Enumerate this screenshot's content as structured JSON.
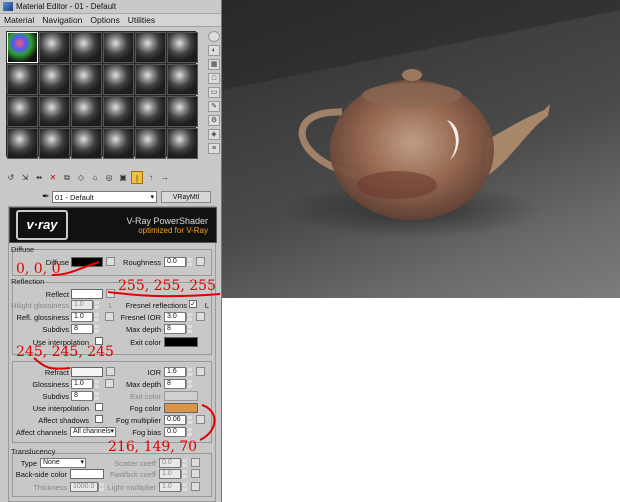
{
  "window": {
    "title": "Material Editor - 01 - Default"
  },
  "menu": [
    "Material",
    "Navigation",
    "Options",
    "Utilities"
  ],
  "material": {
    "name": "01 - Default",
    "type": "VRayMtl"
  },
  "banner": {
    "logo": "v·ray",
    "title": "V-Ray PowerShader",
    "subtitle": "optimized for V-Ray"
  },
  "diffuse": {
    "section": "Diffuse",
    "diffuse_label": "Diffuse",
    "diffuse_color": "#000000",
    "roughness_label": "Roughness",
    "roughness": "0.0"
  },
  "reflection": {
    "section": "Reflection",
    "reflect_label": "Reflect",
    "reflect_color": "#ffffff",
    "hilight_label": "Hilight glossiness",
    "hilight": "1.0",
    "L": "L",
    "fresnel_label": "Fresnel reflections",
    "fresnel_checked": "✓",
    "fresnel_L": "L",
    "refl_gloss_label": "Refl. glossiness",
    "refl_gloss": "1.0",
    "fresnel_ior_label": "Fresnel IOR",
    "fresnel_ior": "3.0",
    "subdivs_label": "Subdivs",
    "subdivs": "8",
    "maxdepth_label": "Max depth",
    "maxdepth": "8",
    "interp_label": "Use interpolation",
    "exit_label": "Exit color",
    "exit_color": "#000000"
  },
  "refraction": {
    "refract_label": "Refract",
    "refract_color": "#f5f5f5",
    "ior_label": "IOR",
    "ior": "1.6",
    "gloss_label": "Glossiness",
    "gloss": "1.0",
    "maxdepth_label": "Max depth",
    "maxdepth": "8",
    "subdivs_label": "Subdivs",
    "subdivs": "8",
    "exit_label": "Exit color",
    "interp_label": "Use interpolation",
    "fogcolor_label": "Fog color",
    "fog_color": "#d89546",
    "shadows_label": "Affect shadows",
    "fogmult_label": "Fog multiplier",
    "fogmult": "0.06",
    "channels_label": "Affect channels",
    "channels": "All channels",
    "fogbias_label": "Fog bias",
    "fogbias": "0.0"
  },
  "translucency": {
    "section": "Translucency",
    "type_label": "Type",
    "type": "None",
    "scatter_label": "Scatter coeff",
    "scatter": "0.0",
    "backside_label": "Back-side color",
    "fwdbck_label": "Fwd/bck coeff",
    "fwdbck": "1.0",
    "thickness_label": "Thickness",
    "thickness": "1000.0",
    "light_label": "Light multiplier",
    "light": "1.0"
  },
  "annotations": {
    "diffuse": "0, 0, 0",
    "reflect": "255, 255, 255",
    "refract": "245, 245, 245",
    "fog": "216, 149, 70",
    "color": "#e00000"
  }
}
